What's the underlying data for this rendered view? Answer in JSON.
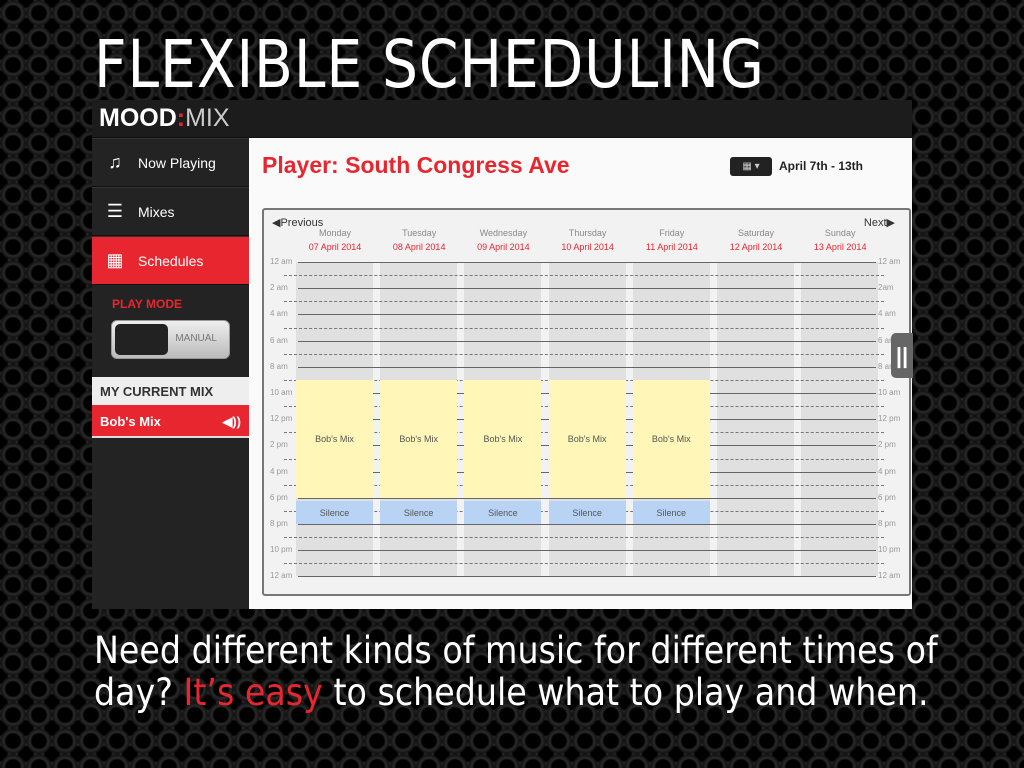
{
  "headline": "FLEXIBLE SCHEDULING",
  "caption": {
    "before": "Need different kinds of music for different times of day? ",
    "highlight": "It’s easy",
    "after": " to schedule what to play and when."
  },
  "logo": {
    "main": "MOOD",
    "sep": ":",
    "sub": "MIX"
  },
  "sidebar": {
    "items": [
      {
        "label": "Now Playing",
        "icon": "music-note-icon"
      },
      {
        "label": "Mixes",
        "icon": "list-icon"
      },
      {
        "label": "Schedules",
        "icon": "calendar-icon",
        "active": true
      }
    ],
    "play_mode_label": "PLAY MODE",
    "toggle_label": "MANUAL",
    "current_mix_header": "MY CURRENT MIX",
    "current_mix": "Bob's Mix"
  },
  "main": {
    "title": "Player: South Congress Ave",
    "date_range": "April 7th - 13th",
    "prev": "Previous",
    "next": "Next"
  },
  "colors": {
    "accent": "#e8262f",
    "mix": "#fff6b8",
    "silence": "#b9d3f5"
  },
  "days": [
    {
      "name": "Monday",
      "date": "07 April 2014"
    },
    {
      "name": "Tuesday",
      "date": "08 April 2014"
    },
    {
      "name": "Wednesday",
      "date": "09 April 2014"
    },
    {
      "name": "Thursday",
      "date": "10 April 2014"
    },
    {
      "name": "Friday",
      "date": "11 April 2014"
    },
    {
      "name": "Saturday",
      "date": "12 April 2014"
    },
    {
      "name": "Sunday",
      "date": "13 April 2014"
    }
  ],
  "hours_left": [
    "12 am",
    "2 am",
    "4 am",
    "6 am",
    "8 am",
    "10 am",
    "12 pm",
    "2 pm",
    "4 pm",
    "6 pm",
    "8 pm",
    "10 pm",
    "12 am"
  ],
  "hours_right": [
    "12 am",
    "2am",
    "4 am",
    "6 am",
    "8 am",
    "10 am",
    "12 pm",
    "2 pm",
    "4 pm",
    "6 pm",
    "8 pm",
    "10 pm",
    "12 am"
  ],
  "events": [
    {
      "day": 0,
      "label": "Bob's Mix",
      "type": "mix",
      "start": 9,
      "end": 18
    },
    {
      "day": 1,
      "label": "Bob's Mix",
      "type": "mix",
      "start": 9,
      "end": 18
    },
    {
      "day": 2,
      "label": "Bob's Mix",
      "type": "mix",
      "start": 9,
      "end": 18
    },
    {
      "day": 3,
      "label": "Bob's Mix",
      "type": "mix",
      "start": 9,
      "end": 18
    },
    {
      "day": 4,
      "label": "Bob's Mix",
      "type": "mix",
      "start": 9,
      "end": 18
    },
    {
      "day": 0,
      "label": "Silence",
      "type": "sil",
      "start": 18.25,
      "end": 20
    },
    {
      "day": 1,
      "label": "Silence",
      "type": "sil",
      "start": 18.25,
      "end": 20
    },
    {
      "day": 2,
      "label": "Silence",
      "type": "sil",
      "start": 18.25,
      "end": 20
    },
    {
      "day": 3,
      "label": "Silence",
      "type": "sil",
      "start": 18.25,
      "end": 20
    },
    {
      "day": 4,
      "label": "Silence",
      "type": "sil",
      "start": 18.25,
      "end": 20
    }
  ]
}
